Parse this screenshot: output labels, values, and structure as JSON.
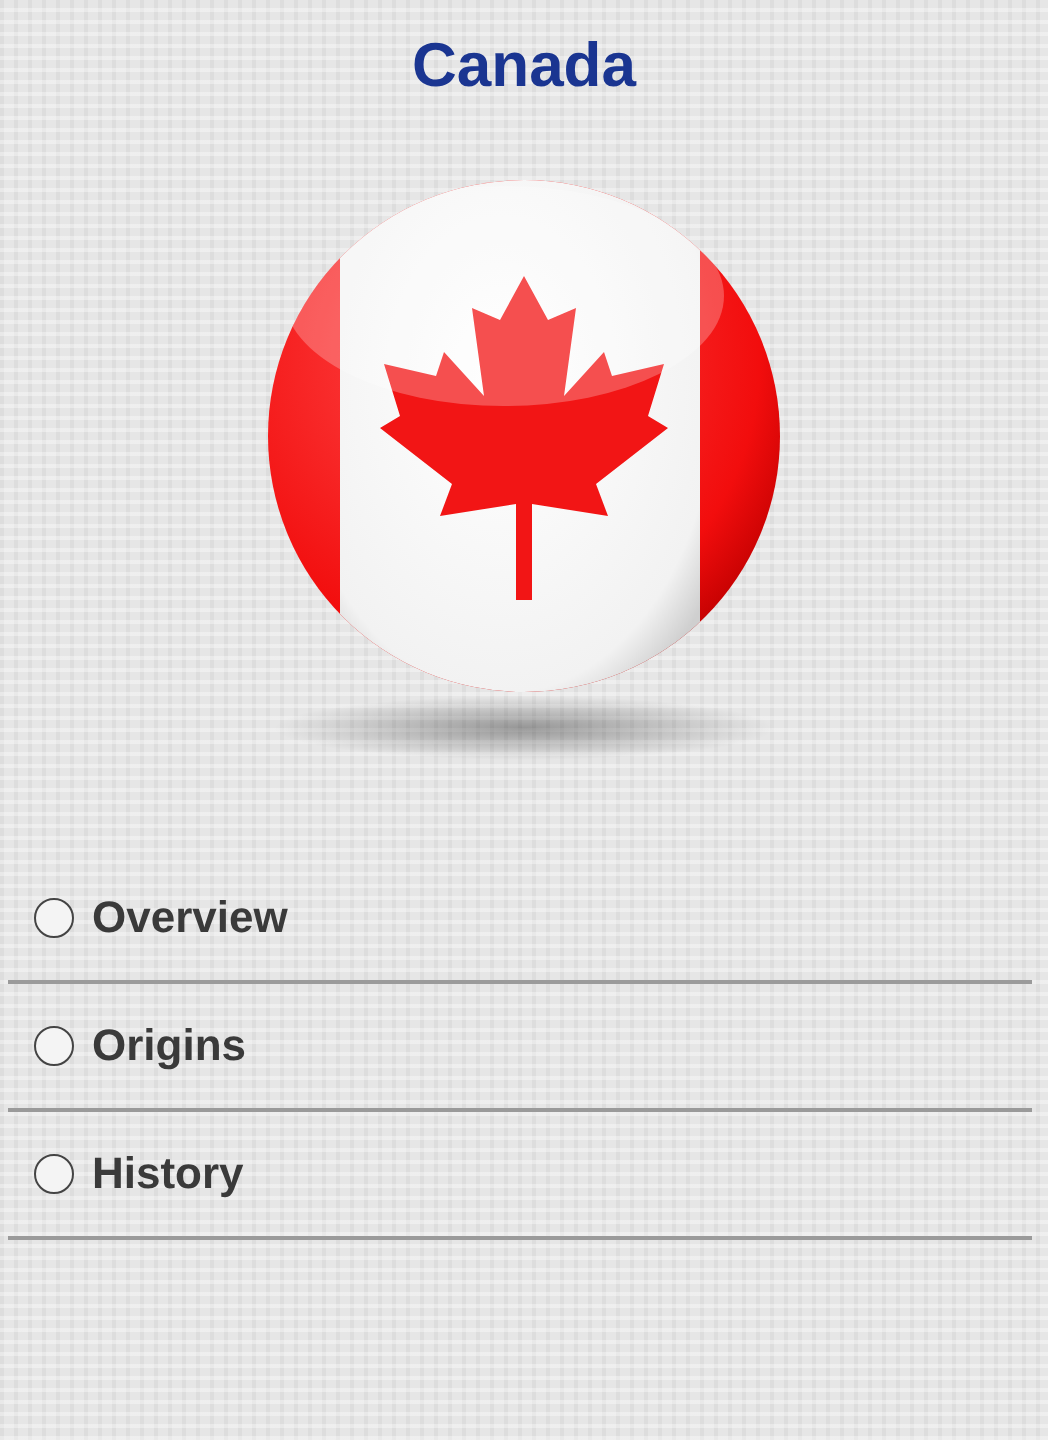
{
  "title": "Canada",
  "items": [
    {
      "label": "Overview",
      "selected": false
    },
    {
      "label": "Origins",
      "selected": false
    },
    {
      "label": "History",
      "selected": false
    }
  ]
}
